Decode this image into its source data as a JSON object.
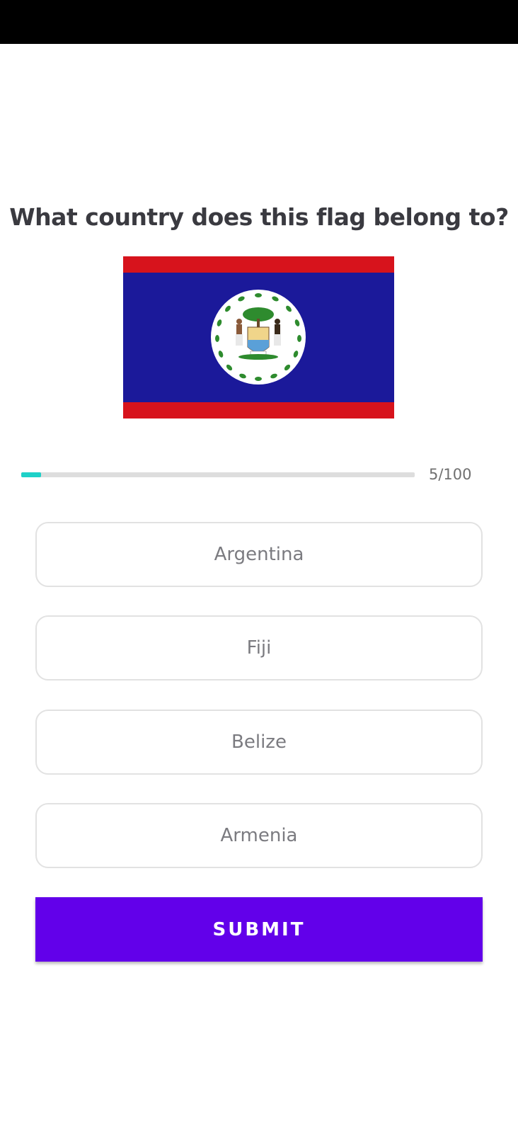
{
  "quiz": {
    "question": "What country does this flag belong to?",
    "flag": {
      "icon": "belize-flag-icon",
      "colors": {
        "red": "#d7131c",
        "blue": "#1b199a",
        "white": "#ffffff",
        "green": "#2e8b2e"
      }
    },
    "progress": {
      "current": 5,
      "total": 100,
      "label": "5/100",
      "fill_color": "#1ed1c8",
      "track_color": "#dddddd"
    },
    "options": [
      {
        "label": "Argentina"
      },
      {
        "label": "Fiji"
      },
      {
        "label": "Belize"
      },
      {
        "label": "Armenia"
      }
    ],
    "submit": {
      "label": "SUBMIT",
      "color": "#6200ea"
    }
  }
}
